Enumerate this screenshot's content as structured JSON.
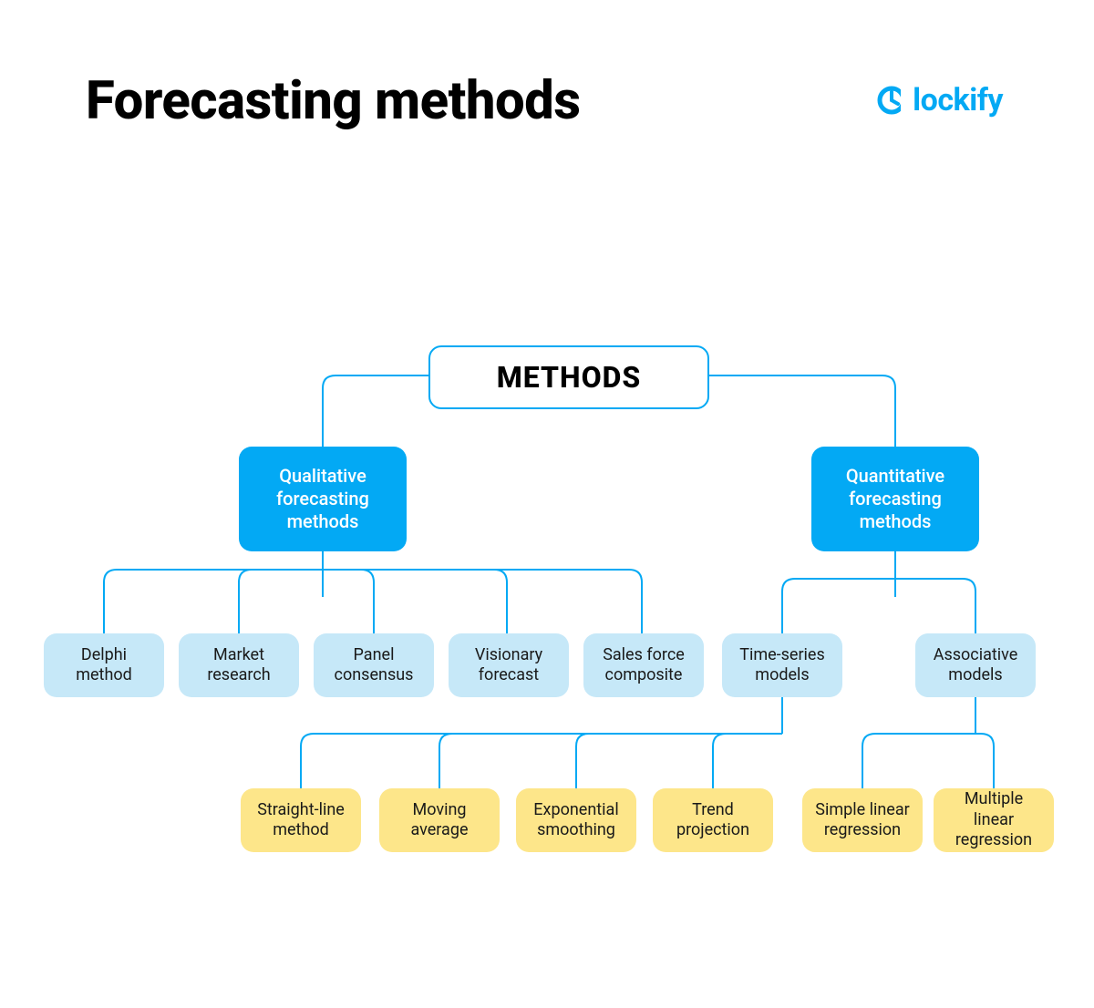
{
  "title": "Forecasting methods",
  "logo": {
    "text": "lockify",
    "icon_name": "clock-icon"
  },
  "colors": {
    "accent": "#03A9F4",
    "light_blue": "#C6E8F8",
    "yellow": "#FDE68A"
  },
  "tree": {
    "root": "METHODS",
    "branches": [
      {
        "label": "Qualitative forecasting methods",
        "children": [
          {
            "label": "Delphi method"
          },
          {
            "label": "Market research"
          },
          {
            "label": "Panel consensus"
          },
          {
            "label": "Visionary forecast"
          },
          {
            "label": "Sales force composite"
          }
        ]
      },
      {
        "label": "Quantitative forecasting methods",
        "children": [
          {
            "label": "Time-series models",
            "children": [
              {
                "label": "Straight-line method"
              },
              {
                "label": "Moving average"
              },
              {
                "label": "Exponential smoothing"
              },
              {
                "label": "Trend projection"
              }
            ]
          },
          {
            "label": "Associative models",
            "children": [
              {
                "label": "Simple linear regression"
              },
              {
                "label": "Multiple linear regression"
              }
            ]
          }
        ]
      }
    ]
  }
}
